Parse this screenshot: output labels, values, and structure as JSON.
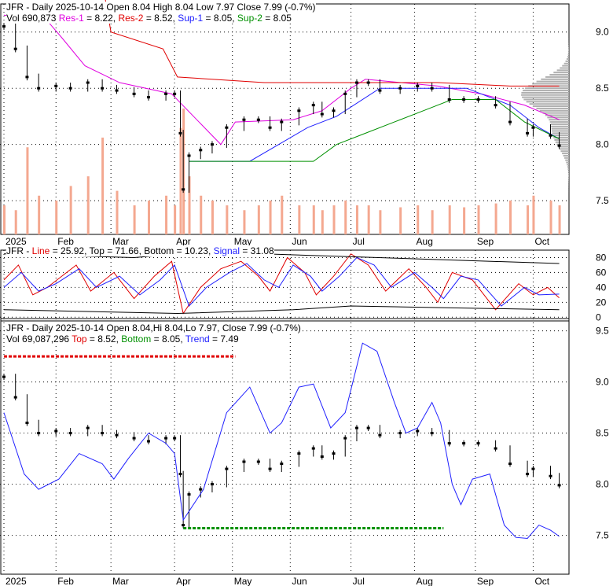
{
  "panel1": {
    "ticker": "JFR",
    "title": "JFR - Daily 2025-10-14 Open 8.04  High 8.04  Low 7.97  Close 7.99 (-0.7%)",
    "vol_label": "Vol 690,873",
    "res1_label": "Res-1",
    "res1_val": " = 8.22, ",
    "res2_label": "Res-2",
    "res2_val": " = 8.52, ",
    "sup1_label": "Sup-1",
    "sup1_val": " = 8.05, ",
    "sup2_label": "Sup-2",
    "sup2_val": " = 8.05"
  },
  "panel2": {
    "prefix": "JFR - ",
    "line_label": "Line",
    "line_val": " = 25.92, Top = 71.66, Bottom = 10.23, ",
    "signal_label": "Signal",
    "signal_val": " = 31.08"
  },
  "panel3": {
    "title": "JFR - Daily 2025-10-14 Open 8.04,Hi 8.04,Lo 7.97, Close 7.99 (-0.7%)",
    "vol_label": "Vol 69,087,296 ",
    "top_label": "Top",
    "top_val": " = 8.52, ",
    "bottom_label": "Bottom",
    "bottom_val": " = 8.05, ",
    "trend_label": "Trend",
    "trend_val": " = 7.49"
  },
  "chart_data": [
    {
      "type": "line",
      "title": "JFR - Daily price with support/resistance",
      "x_unit": "trading day index",
      "ylim": [
        7.2,
        9.2
      ],
      "yticks": [
        "9.0",
        "8.5",
        "8.0",
        "7.5"
      ],
      "xticks": [
        "2025",
        "Feb",
        "Mar",
        "Apr",
        "May",
        "Jun",
        "Jul",
        "Aug",
        "Sep",
        "Oct"
      ],
      "xtick_days": [
        0,
        18,
        37,
        59,
        79,
        99,
        120,
        142,
        163,
        183
      ],
      "close": [
        [
          0,
          9.05
        ],
        [
          4,
          8.85
        ],
        [
          8,
          8.6
        ],
        [
          12,
          8.5
        ],
        [
          18,
          8.52
        ],
        [
          23,
          8.5
        ],
        [
          29,
          8.55
        ],
        [
          34,
          8.5
        ],
        [
          39,
          8.48
        ],
        [
          45,
          8.45
        ],
        [
          50,
          8.42
        ],
        [
          56,
          8.45
        ],
        [
          59,
          8.45
        ],
        [
          61,
          8.1
        ],
        [
          62,
          7.6
        ],
        [
          64,
          7.9
        ],
        [
          68,
          7.95
        ],
        [
          72,
          8.0
        ],
        [
          77,
          8.15
        ],
        [
          83,
          8.22
        ],
        [
          88,
          8.22
        ],
        [
          92,
          8.15
        ],
        [
          96,
          8.2
        ],
        [
          102,
          8.3
        ],
        [
          107,
          8.35
        ],
        [
          110,
          8.27
        ],
        [
          114,
          8.3
        ],
        [
          118,
          8.45
        ],
        [
          122,
          8.55
        ],
        [
          126,
          8.55
        ],
        [
          130,
          8.48
        ],
        [
          137,
          8.5
        ],
        [
          143,
          8.52
        ],
        [
          148,
          8.5
        ],
        [
          154,
          8.4
        ],
        [
          159,
          8.4
        ],
        [
          164,
          8.4
        ],
        [
          170,
          8.35
        ],
        [
          175,
          8.2
        ],
        [
          181,
          8.1
        ],
        [
          183,
          8.15
        ],
        [
          189,
          8.08
        ],
        [
          192,
          7.99
        ]
      ],
      "volume": [
        300,
        250,
        900,
        400,
        350,
        500,
        600,
        1000,
        450,
        300,
        350,
        400,
        300,
        1100,
        1300,
        600,
        400,
        350,
        300,
        250,
        300,
        350,
        400,
        300,
        300,
        250,
        300,
        350,
        300,
        300,
        250,
        280,
        300,
        250,
        300,
        280,
        300,
        320,
        350,
        300,
        400,
        350,
        300
      ],
      "series": [
        {
          "name": "Res-1",
          "color": "#e000e0",
          "points": [
            [
              0,
              9.15
            ],
            [
              15,
              9.1
            ],
            [
              20,
              8.95
            ],
            [
              28,
              8.7
            ],
            [
              40,
              8.55
            ],
            [
              58,
              8.45
            ],
            [
              75,
              8.0
            ],
            [
              80,
              8.2
            ],
            [
              100,
              8.22
            ],
            [
              110,
              8.3
            ],
            [
              120,
              8.5
            ],
            [
              125,
              8.58
            ],
            [
              150,
              8.52
            ],
            [
              165,
              8.45
            ],
            [
              180,
              8.35
            ],
            [
              192,
              8.22
            ]
          ]
        },
        {
          "name": "Res-2",
          "color": "#e00000",
          "points": [
            [
              0,
              9.3
            ],
            [
              35,
              9.3
            ],
            [
              37,
              9.0
            ],
            [
              55,
              8.85
            ],
            [
              60,
              8.6
            ],
            [
              90,
              8.55
            ],
            [
              110,
              8.55
            ],
            [
              150,
              8.55
            ],
            [
              175,
              8.52
            ],
            [
              192,
              8.52
            ]
          ]
        },
        {
          "name": "Sup-1",
          "color": "#2020ff",
          "points": [
            [
              64,
              7.85
            ],
            [
              85,
              7.85
            ],
            [
              95,
              8.0
            ],
            [
              105,
              8.15
            ],
            [
              115,
              8.25
            ],
            [
              130,
              8.5
            ],
            [
              160,
              8.5
            ],
            [
              175,
              8.35
            ],
            [
              185,
              8.15
            ],
            [
              192,
              8.05
            ]
          ]
        },
        {
          "name": "Sup-2",
          "color": "#009000",
          "points": [
            [
              64,
              7.85
            ],
            [
              107,
              7.85
            ],
            [
              115,
              8.0
            ],
            [
              125,
              8.1
            ],
            [
              135,
              8.2
            ],
            [
              145,
              8.3
            ],
            [
              155,
              8.4
            ],
            [
              170,
              8.4
            ],
            [
              180,
              8.2
            ],
            [
              192,
              8.05
            ]
          ]
        }
      ]
    },
    {
      "type": "line",
      "title": "JFR - Stochastic",
      "ylim": [
        0,
        90
      ],
      "yticks": [
        "80",
        "60",
        "40",
        "20",
        "0"
      ],
      "series": [
        {
          "name": "Line",
          "color": "#e00000",
          "points": [
            [
              0,
              50
            ],
            [
              5,
              70
            ],
            [
              10,
              30
            ],
            [
              15,
              40
            ],
            [
              25,
              70
            ],
            [
              30,
              35
            ],
            [
              38,
              60
            ],
            [
              45,
              25
            ],
            [
              52,
              55
            ],
            [
              58,
              75
            ],
            [
              62,
              5
            ],
            [
              68,
              40
            ],
            [
              75,
              65
            ],
            [
              82,
              75
            ],
            [
              88,
              55
            ],
            [
              92,
              35
            ],
            [
              98,
              80
            ],
            [
              104,
              60
            ],
            [
              108,
              30
            ],
            [
              114,
              55
            ],
            [
              120,
              85
            ],
            [
              126,
              70
            ],
            [
              132,
              35
            ],
            [
              140,
              65
            ],
            [
              146,
              40
            ],
            [
              150,
              20
            ],
            [
              155,
              60
            ],
            [
              162,
              50
            ],
            [
              170,
              10
            ],
            [
              178,
              45
            ],
            [
              183,
              30
            ],
            [
              188,
              40
            ],
            [
              192,
              26
            ]
          ]
        },
        {
          "name": "Signal",
          "color": "#2020ff",
          "points": [
            [
              0,
              40
            ],
            [
              6,
              60
            ],
            [
              12,
              35
            ],
            [
              18,
              45
            ],
            [
              26,
              65
            ],
            [
              32,
              40
            ],
            [
              40,
              55
            ],
            [
              47,
              30
            ],
            [
              54,
              50
            ],
            [
              59,
              70
            ],
            [
              64,
              15
            ],
            [
              70,
              40
            ],
            [
              78,
              60
            ],
            [
              84,
              72
            ],
            [
              90,
              50
            ],
            [
              95,
              40
            ],
            [
              100,
              70
            ],
            [
              106,
              55
            ],
            [
              110,
              35
            ],
            [
              116,
              55
            ],
            [
              122,
              80
            ],
            [
              128,
              70
            ],
            [
              134,
              40
            ],
            [
              142,
              60
            ],
            [
              148,
              40
            ],
            [
              152,
              25
            ],
            [
              158,
              55
            ],
            [
              164,
              50
            ],
            [
              172,
              15
            ],
            [
              180,
              40
            ],
            [
              185,
              30
            ],
            [
              192,
              31
            ]
          ]
        },
        {
          "name": "Top",
          "color": "#000000",
          "points": [
            [
              0,
              85
            ],
            [
              45,
              80
            ],
            [
              60,
              85
            ],
            [
              90,
              85
            ],
            [
              192,
              72
            ]
          ]
        },
        {
          "name": "Bottom",
          "color": "#000000",
          "points": [
            [
              0,
              10
            ],
            [
              60,
              5
            ],
            [
              100,
              10
            ],
            [
              120,
              15
            ],
            [
              192,
              10
            ]
          ]
        }
      ]
    },
    {
      "type": "line",
      "title": "JFR - Daily with trend",
      "ylim": [
        7.1,
        9.55
      ],
      "yticks": [
        "9.5",
        "9.0",
        "8.5",
        "8.0",
        "7.5"
      ],
      "series": [
        {
          "name": "Trend",
          "color": "#2020ff",
          "points": [
            [
              0,
              8.7
            ],
            [
              7,
              8.1
            ],
            [
              12,
              7.95
            ],
            [
              19,
              8.05
            ],
            [
              26,
              8.3
            ],
            [
              34,
              8.2
            ],
            [
              38,
              8.05
            ],
            [
              43,
              8.25
            ],
            [
              50,
              8.5
            ],
            [
              56,
              8.4
            ],
            [
              59,
              8.3
            ],
            [
              62,
              7.65
            ],
            [
              69,
              7.95
            ],
            [
              77,
              8.7
            ],
            [
              85,
              8.95
            ],
            [
              92,
              8.5
            ],
            [
              96,
              8.6
            ],
            [
              102,
              8.95
            ],
            [
              107,
              8.98
            ],
            [
              113,
              8.55
            ],
            [
              118,
              8.7
            ],
            [
              124,
              9.38
            ],
            [
              129,
              9.3
            ],
            [
              135,
              8.8
            ],
            [
              139,
              8.5
            ],
            [
              143,
              8.55
            ],
            [
              148,
              8.8
            ],
            [
              151,
              8.6
            ],
            [
              155,
              8.0
            ],
            [
              158,
              7.8
            ],
            [
              162,
              8.05
            ],
            [
              168,
              8.1
            ],
            [
              173,
              7.6
            ],
            [
              177,
              7.48
            ],
            [
              181,
              7.47
            ],
            [
              185,
              7.6
            ],
            [
              189,
              7.55
            ],
            [
              192,
              7.49
            ]
          ]
        },
        {
          "name": "Top",
          "color": "#e00000",
          "points": [
            [
              0,
              9.25
            ],
            [
              80,
              9.25
            ]
          ]
        },
        {
          "name": "Bottom",
          "color": "#009000",
          "points": [
            [
              62,
              7.57
            ],
            [
              152,
              7.57
            ]
          ]
        }
      ]
    }
  ]
}
